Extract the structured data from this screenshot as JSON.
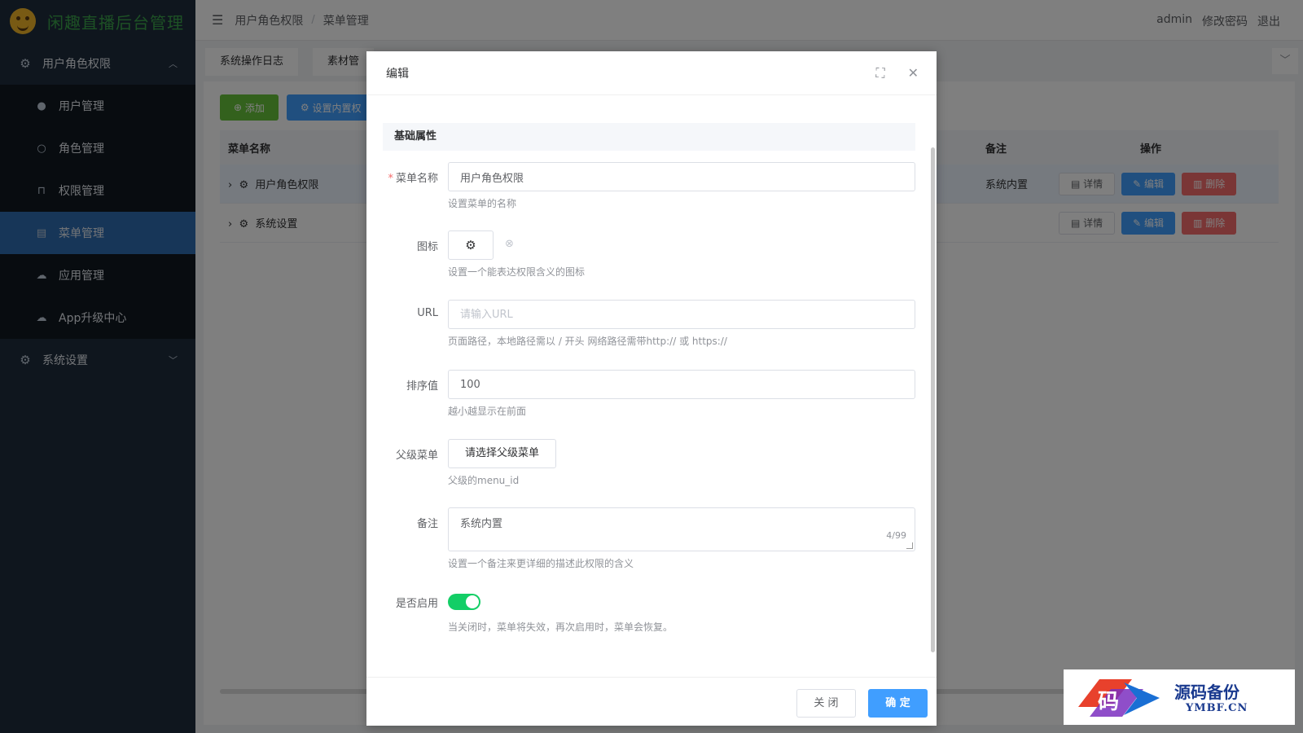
{
  "app": {
    "title": "闲趣直播后台管理"
  },
  "sidebar": {
    "groups": [
      {
        "label": "用户角色权限",
        "expanded": true
      },
      {
        "label": "系统设置",
        "expanded": false
      }
    ],
    "items": [
      {
        "label": "用户管理",
        "icon": "user-icon"
      },
      {
        "label": "角色管理",
        "icon": "user-outline-icon"
      },
      {
        "label": "权限管理",
        "icon": "lock-icon"
      },
      {
        "label": "菜单管理",
        "icon": "document-icon",
        "active": true
      },
      {
        "label": "应用管理",
        "icon": "cloud-icon"
      },
      {
        "label": "App升级中心",
        "icon": "cloud-upload-icon"
      }
    ]
  },
  "header": {
    "breadcrumb": [
      "用户角色权限",
      "菜单管理"
    ],
    "separator": "/",
    "user": "admin",
    "change_password": "修改密码",
    "logout": "退出"
  },
  "tabs": [
    {
      "label": "系统操作日志"
    },
    {
      "label": "素材管"
    }
  ],
  "toolbar": {
    "add": "添加",
    "set_builtin": "设置内置权"
  },
  "table": {
    "headers": {
      "name": "菜单名称",
      "note": "备注",
      "ops": "操作"
    },
    "rows": [
      {
        "name": "用户角色权限",
        "note": "系统内置"
      },
      {
        "name": "系统设置",
        "note": ""
      }
    ],
    "ops": {
      "detail": "详情",
      "edit": "编辑",
      "delete": "删除"
    }
  },
  "dialog": {
    "title": "编辑",
    "section": "基础属性",
    "fields": {
      "name": {
        "label": "菜单名称",
        "value": "用户角色权限",
        "hint": "设置菜单的名称",
        "required": "*"
      },
      "icon": {
        "label": "图标",
        "hint": "设置一个能表达权限含义的图标"
      },
      "url": {
        "label": "URL",
        "placeholder": "请输入URL",
        "hint": "页面路径，本地路径需以 / 开头 网络路径需带http:// 或 https://"
      },
      "sort": {
        "label": "排序值",
        "value": "100",
        "hint": "越小越显示在前面"
      },
      "parent": {
        "label": "父级菜单",
        "button": "请选择父级菜单",
        "hint": "父级的menu_id"
      },
      "note": {
        "label": "备注",
        "value": "系统内置",
        "count": "4/99",
        "hint": "设置一个备注来更详细的描述此权限的含义"
      },
      "enabled": {
        "label": "是否启用",
        "value": true,
        "hint": "当关闭时，菜单将失效，再次启用时，菜单会恢复。"
      }
    },
    "footer": {
      "cancel": "关 闭",
      "confirm": "确 定"
    }
  },
  "watermark": {
    "cn": "源码备份",
    "en": "YMBF.CN"
  },
  "colors": {
    "sidebar": "#1f2d3d",
    "active": "#2f6db0",
    "primary": "#409eff",
    "success": "#67c23a",
    "danger": "#f56c6c",
    "switch_on": "#13ce66"
  }
}
